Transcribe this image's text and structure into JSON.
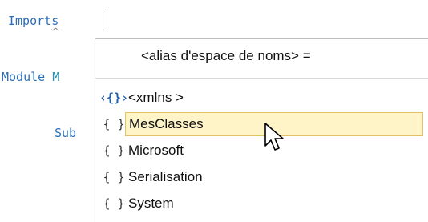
{
  "editor": {
    "line1_keyword": "Imports",
    "line2_keyword": "Module",
    "line2_ident": "M",
    "line3_keyword": "Sub"
  },
  "popup": {
    "header": "<alias d'espace de noms> =",
    "items": [
      {
        "icon": "xmlns-icon",
        "glyph": "‹{}›",
        "label": "<xmlns >"
      },
      {
        "icon": "namespace-icon",
        "glyph": "{ }",
        "label": "MesClasses",
        "selected": true
      },
      {
        "icon": "namespace-icon",
        "glyph": "{ }",
        "label": "Microsoft"
      },
      {
        "icon": "namespace-icon",
        "glyph": "{ }",
        "label": "Serialisation"
      },
      {
        "icon": "namespace-icon",
        "glyph": "{ }",
        "label": "System"
      }
    ]
  },
  "colors": {
    "keyword": "#2b6fb8",
    "selection_bg": "#fff3c8",
    "selection_border": "#e5c365"
  }
}
